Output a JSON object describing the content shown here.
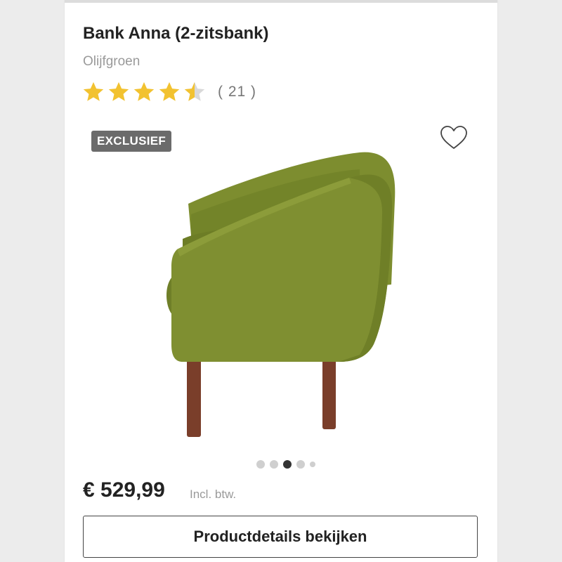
{
  "product": {
    "title": "Bank Anna (2-zitsbank)",
    "color_name": "Olijfgroen",
    "rating": 4.5,
    "rating_max": 5,
    "review_count": "( 21 )",
    "badge": "EXCLUSIEF",
    "price": "€ 529,99",
    "vat_note": "Incl. btw.",
    "cta_label": "Productdetails bekijken"
  },
  "carousel": {
    "total_dots": 5,
    "active_index": 2
  },
  "icons": {
    "star": "star-icon",
    "heart": "heart-outline-icon"
  },
  "colors": {
    "star": "#f2c230",
    "star_empty": "#d9d9d9",
    "badge_bg": "#6b6b6b",
    "sofa": "#7a8a2e",
    "legs": "#7a3e2a"
  }
}
